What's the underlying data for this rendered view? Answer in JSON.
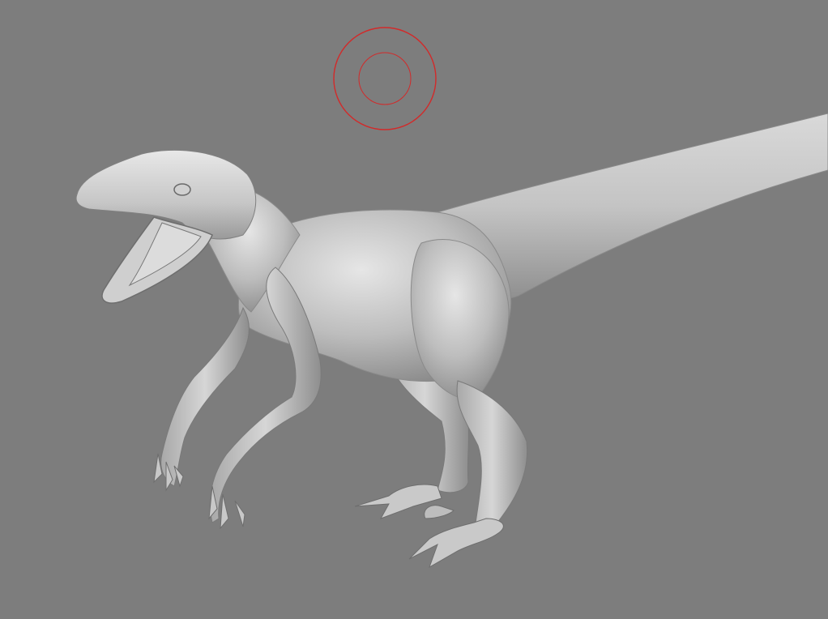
{
  "viewport": {
    "background": "#7d7d7d",
    "model": {
      "name": "raptor-sculpt",
      "material": "matcap-grey",
      "base_color": "#b9b9b9",
      "highlight_color": "#ececec",
      "shadow_color": "#6a6a6a"
    },
    "brush_cursor": {
      "icon": "brush-circle-icon",
      "color": "#d22a2a"
    }
  }
}
